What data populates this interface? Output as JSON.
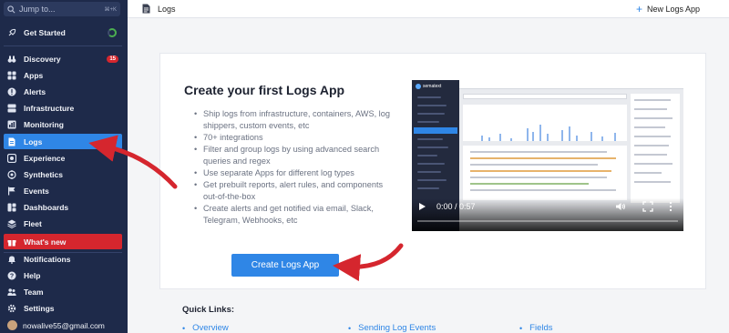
{
  "sidebar": {
    "search": {
      "placeholder": "Jump to...",
      "shortcut": "⌘+K"
    },
    "items": [
      {
        "label": "Get Started",
        "icon": "rocket-icon"
      },
      {
        "label": "Discovery",
        "icon": "binoculars-icon",
        "badge": "15"
      },
      {
        "label": "Apps",
        "icon": "grid-icon"
      },
      {
        "label": "Alerts",
        "icon": "alert-icon"
      },
      {
        "label": "Infrastructure",
        "icon": "server-icon"
      },
      {
        "label": "Monitoring",
        "icon": "chart-icon"
      },
      {
        "label": "Logs",
        "icon": "doc-icon"
      },
      {
        "label": "Experience",
        "icon": "experience-icon"
      },
      {
        "label": "Synthetics",
        "icon": "synthetics-icon"
      },
      {
        "label": "Events",
        "icon": "flag-icon"
      },
      {
        "label": "Dashboards",
        "icon": "dashboard-icon"
      },
      {
        "label": "Fleet",
        "icon": "fleet-icon"
      },
      {
        "label": "What's new",
        "icon": "gift-icon"
      },
      {
        "label": "Notifications",
        "icon": "bell-icon"
      },
      {
        "label": "Help",
        "icon": "help-icon"
      },
      {
        "label": "Team",
        "icon": "team-icon"
      },
      {
        "label": "Settings",
        "icon": "gear-icon"
      }
    ],
    "user": {
      "email": "nowalive55@gmail.com"
    }
  },
  "topbar": {
    "title": "Logs",
    "new_app_label": "New Logs App"
  },
  "card": {
    "title": "Create your first Logs App",
    "bullets": [
      "Ship logs from infrastructure, containers, AWS, log shippers, custom events, etc",
      "70+ integrations",
      "Filter and group logs by using advanced search queries and regex",
      "Use separate Apps for different log types",
      "Get prebuilt reports, alert rules, and components out-of-the-box",
      "Create alerts and get notified via email, Slack, Telegram, Webhooks, etc"
    ],
    "button_label": "Create Logs App",
    "video": {
      "time": "0:00 / 0:57",
      "brand": "sematext",
      "progress": 0
    }
  },
  "quick_links": {
    "title": "Quick Links:",
    "links": [
      "Overview",
      "Sending Log Events",
      "Fields"
    ]
  },
  "colors": {
    "sidebar": "#1e2a4a",
    "active": "#2f86e6",
    "whats_new": "#d5262e",
    "arrow": "#d5262e"
  }
}
